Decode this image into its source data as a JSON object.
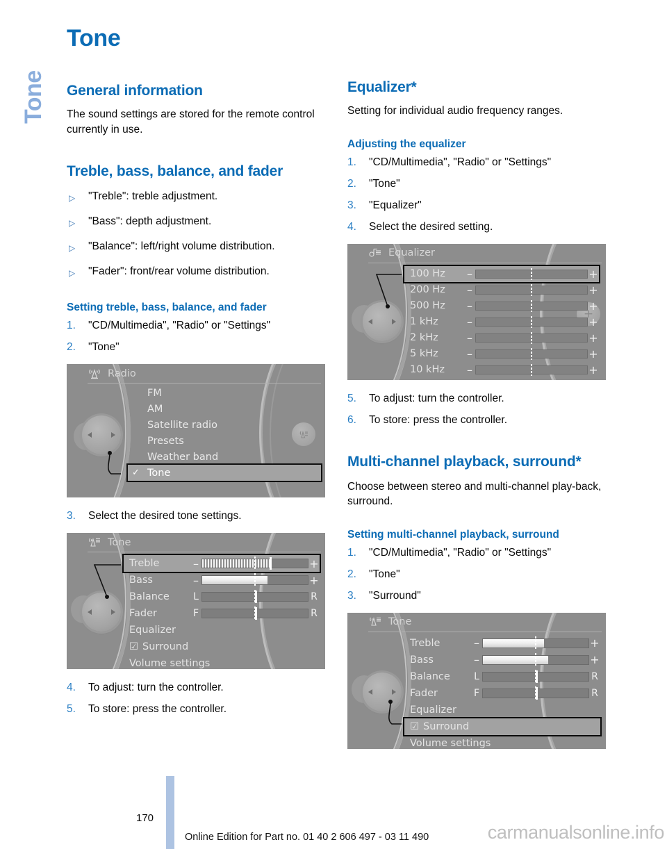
{
  "chapter_tab": "Tone",
  "page_title": "Tone",
  "left_column": {
    "general": {
      "heading": "General information",
      "body": "The sound settings are stored for the remote control currently in use."
    },
    "treble_section": {
      "heading": "Treble, bass, balance, and fader",
      "bullets": [
        "\"Treble\": treble adjustment.",
        "\"Bass\": depth adjustment.",
        "\"Balance\": left/right volume distribution.",
        "\"Fader\": front/rear volume distribution."
      ],
      "sub_heading": "Setting treble, bass, balance, and fader",
      "steps_before": [
        {
          "num": "1.",
          "text": "\"CD/Multimedia\", \"Radio\" or \"Settings\""
        },
        {
          "num": "2.",
          "text": "\"Tone\""
        }
      ],
      "step_middle": {
        "num": "3.",
        "text": "Select the desired tone settings."
      },
      "steps_after": [
        {
          "num": "4.",
          "text": "To adjust: turn the controller."
        },
        {
          "num": "5.",
          "text": "To store: press the controller."
        }
      ]
    },
    "radio_screen": {
      "title": "Radio",
      "icon": "radio-antenna-icon",
      "items": [
        {
          "label": "FM",
          "selected": false,
          "check": ""
        },
        {
          "label": "AM",
          "selected": false,
          "check": ""
        },
        {
          "label": "Satellite radio",
          "selected": false,
          "check": ""
        },
        {
          "label": "Presets",
          "selected": false,
          "check": ""
        },
        {
          "label": "Weather band",
          "selected": false,
          "check": ""
        },
        {
          "label": "Tone",
          "selected": true,
          "check": "✓"
        }
      ]
    },
    "tone_screen": {
      "title": "Tone",
      "icon": "tone-icon",
      "rows": [
        {
          "label": "Treble",
          "type": "pm",
          "left": "–",
          "right": "+",
          "fill": 64,
          "ribbed": true,
          "selected": true
        },
        {
          "label": "Bass",
          "type": "pm",
          "left": "–",
          "right": "+",
          "fill": 62,
          "ribbed": false,
          "selected": false
        },
        {
          "label": "Balance",
          "type": "lr",
          "left": "L",
          "right": "R",
          "thumb": 50,
          "selected": false
        },
        {
          "label": "Fader",
          "type": "lr",
          "left": "F",
          "right": "R",
          "thumb": 50,
          "selected": false
        },
        {
          "label": "Equalizer",
          "type": "plain",
          "selected": false
        },
        {
          "label": "Surround",
          "type": "check",
          "check": "☑",
          "selected": false
        },
        {
          "label": "Volume settings",
          "type": "plain",
          "selected": false
        }
      ]
    }
  },
  "right_column": {
    "equalizer": {
      "heading": "Equalizer*",
      "body": "Setting for individual audio frequency ranges.",
      "sub_heading": "Adjusting the equalizer",
      "steps_before": [
        {
          "num": "1.",
          "text": "\"CD/Multimedia\", \"Radio\" or \"Settings\""
        },
        {
          "num": "2.",
          "text": "\"Tone\""
        },
        {
          "num": "3.",
          "text": "\"Equalizer\""
        },
        {
          "num": "4.",
          "text": "Select the desired setting."
        }
      ],
      "steps_after": [
        {
          "num": "5.",
          "text": "To adjust: turn the controller."
        },
        {
          "num": "6.",
          "text": "To store: press the controller."
        }
      ]
    },
    "equalizer_screen": {
      "title": "Equalizer",
      "icon": "equalizer-note-icon",
      "rows": [
        {
          "label": "100 Hz",
          "left": "–",
          "right": "+",
          "selected": true
        },
        {
          "label": "200 Hz",
          "left": "–",
          "right": "+",
          "selected": false
        },
        {
          "label": "500 Hz",
          "left": "–",
          "right": "+",
          "selected": false
        },
        {
          "label": "1 kHz",
          "left": "–",
          "right": "+",
          "selected": false
        },
        {
          "label": "2 kHz",
          "left": "–",
          "right": "+",
          "selected": false
        },
        {
          "label": "5 kHz",
          "left": "–",
          "right": "+",
          "selected": false
        },
        {
          "label": "10 kHz",
          "left": "–",
          "right": "+",
          "selected": false
        }
      ]
    },
    "multichannel": {
      "heading": "Multi-channel playback, surround*",
      "body": "Choose between stereo and multi-channel play-back, surround.",
      "sub_heading": "Setting multi-channel playback, surround",
      "steps": [
        {
          "num": "1.",
          "text": "\"CD/Multimedia\", \"Radio\" or \"Settings\""
        },
        {
          "num": "2.",
          "text": "\"Tone\""
        },
        {
          "num": "3.",
          "text": "\"Surround\""
        }
      ]
    },
    "surround_screen": {
      "title": "Tone",
      "icon": "tone-icon",
      "rows": [
        {
          "label": "Treble",
          "type": "pm",
          "left": "–",
          "right": "+",
          "fill": 58,
          "ribbed": false,
          "selected": false
        },
        {
          "label": "Bass",
          "type": "pm",
          "left": "–",
          "right": "+",
          "fill": 62,
          "ribbed": false,
          "selected": false
        },
        {
          "label": "Balance",
          "type": "lr",
          "left": "L",
          "right": "R",
          "thumb": 50,
          "selected": false
        },
        {
          "label": "Fader",
          "type": "lr",
          "left": "F",
          "right": "R",
          "thumb": 50,
          "selected": false
        },
        {
          "label": "Equalizer",
          "type": "plain",
          "selected": false
        },
        {
          "label": "Surround",
          "type": "check",
          "check": "☑",
          "selected": true
        },
        {
          "label": "Volume settings",
          "type": "plain",
          "selected": false
        }
      ]
    }
  },
  "footer": {
    "page_number": "170",
    "edition_line": "Online Edition for Part no. 01 40 2 606 497 - 03 11 490",
    "watermark": "carmanualsonline.info"
  },
  "colors": {
    "heading_blue": "#0c6cb5",
    "tab_blue": "#8aaddc",
    "number_blue": "#2a7fc4",
    "footer_bar_blue": "#adc3e2"
  }
}
